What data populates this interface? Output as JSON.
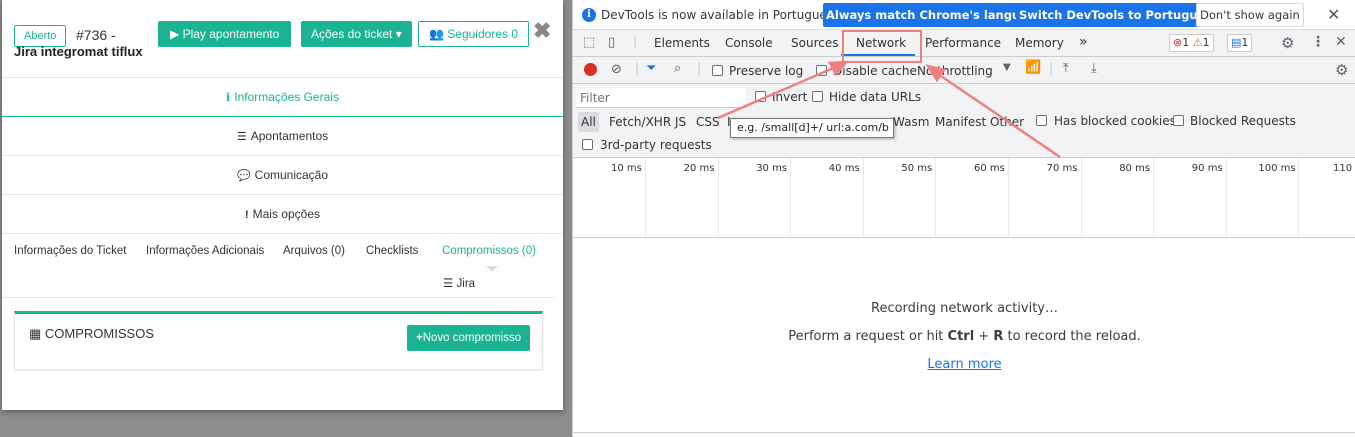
{
  "modal": {
    "status_badge": "Aberto",
    "ticket_number": "#736 -",
    "ticket_title": "Jira integromat tiflux",
    "play_button": "Play apontamento",
    "actions_button": "Ações do ticket",
    "followers_button": "Seguidores 0",
    "sections": [
      "Informações Gerais",
      "Apontamentos",
      "Comunicação",
      "Mais opções"
    ],
    "tabs": [
      "Informações do Ticket",
      "Informações Adicionais",
      "Arquivos (0)",
      "Checklists",
      "Compromissos (0)"
    ],
    "tab_jira": "Jira",
    "panel_title": "COMPROMISSOS",
    "new_button": "Novo compromisso"
  },
  "devtools": {
    "info_text": "DevTools is now available in Portuguese!",
    "match_button": "Always match Chrome's language",
    "switch_button": "Switch DevTools to Portuguese",
    "dismiss_button": "Don't show again",
    "tabs": [
      "Elements",
      "Console",
      "Sources",
      "Network",
      "Performance",
      "Memory"
    ],
    "active_tab": "Network",
    "more_tabs": "»",
    "counts": {
      "errors": "1",
      "warnings": "1",
      "messages": "1"
    },
    "preserve_log": "Preserve log",
    "disable_cache": "Disable cache",
    "throttling": "No throttling",
    "filter_placeholder": "Filter",
    "invert": "Invert",
    "hide_data_urls": "Hide data URLs",
    "type_filters": [
      "All",
      "Fetch/XHR",
      "JS",
      "CSS",
      "Wasm",
      "Manifest",
      "Other"
    ],
    "type_filter_partial": "I",
    "has_blocked_cookies": "Has blocked cookies",
    "blocked_requests": "Blocked Requests",
    "third_party": "3rd-party requests",
    "tooltip": "e.g. /small[d]+/ url:a.com/b",
    "timeline_ticks": [
      "10 ms",
      "20 ms",
      "30 ms",
      "40 ms",
      "50 ms",
      "60 ms",
      "70 ms",
      "80 ms",
      "90 ms",
      "100 ms",
      "110"
    ],
    "recording_text": "Recording network activity…",
    "reload_text_prefix": "Perform a request or hit ",
    "reload_key1": "Ctrl",
    "reload_plus": " + ",
    "reload_key2": "R",
    "reload_text_suffix": " to record the reload.",
    "learn_more": "Learn more"
  },
  "colors": {
    "accent": "#1ab394",
    "devtools_blue": "#1a73e8",
    "annotation": "#f08080"
  }
}
